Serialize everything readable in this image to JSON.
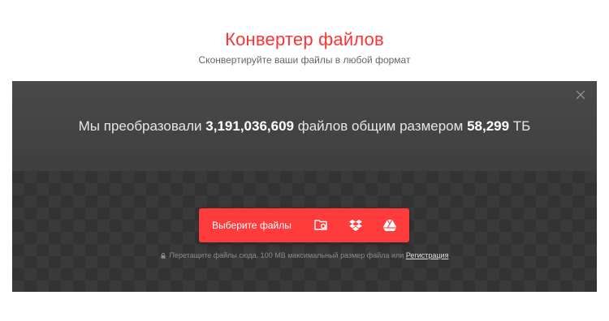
{
  "header": {
    "title": "Конвертер файлов",
    "subtitle": "Сконвертируйте ваши файлы в любой формат"
  },
  "stats": {
    "prefix": "Мы преобразовали",
    "files_count": "3,191,036,609",
    "middle": "файлов общим размером",
    "total_size": "58,299",
    "unit": "ТБ"
  },
  "upload": {
    "choose_files_label": "Выберите файлы",
    "icons": [
      "folder-search-icon",
      "dropbox-icon",
      "google-drive-icon"
    ]
  },
  "hint": {
    "text": "Перетащите файлы сюда. 100 MB максимальный размер файла или",
    "register_link": "Регистрация"
  },
  "colors": {
    "accent": "#ff3333",
    "button": "#ff3b3b",
    "panel_dark": "#333333"
  },
  "icons": {
    "close": "close-icon",
    "lock": "lock-icon"
  }
}
